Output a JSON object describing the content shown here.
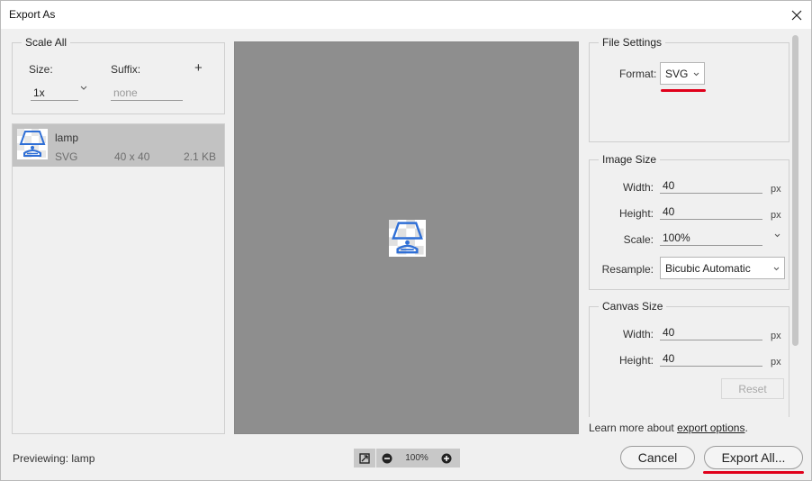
{
  "window": {
    "title": "Export As"
  },
  "scale_all": {
    "legend": "Scale All",
    "size_label": "Size:",
    "suffix_label": "Suffix:",
    "size_value": "1x",
    "suffix_placeholder": "none",
    "add_glyph": "+"
  },
  "files": [
    {
      "name": "lamp",
      "type": "SVG",
      "dims": "40 x 40",
      "size": "2.1 KB",
      "icon": "lamp-thumbnail-icon"
    }
  ],
  "previewing": {
    "label": "Previewing:",
    "name": "lamp"
  },
  "zoom": {
    "value": "100%"
  },
  "file_settings": {
    "legend": "File Settings",
    "format_label": "Format:",
    "format_value": "SVG"
  },
  "image_size": {
    "legend": "Image Size",
    "width_label": "Width:",
    "width_value": "40",
    "width_unit": "px",
    "height_label": "Height:",
    "height_value": "40",
    "height_unit": "px",
    "scale_label": "Scale:",
    "scale_value": "100%",
    "resample_label": "Resample:",
    "resample_value": "Bicubic Automatic"
  },
  "canvas_size": {
    "legend": "Canvas Size",
    "width_label": "Width:",
    "width_value": "40",
    "width_unit": "px",
    "height_label": "Height:",
    "height_value": "40",
    "height_unit": "px",
    "reset_label": "Reset"
  },
  "learn_more": {
    "prefix": "Learn more about ",
    "link": "export options",
    "suffix": "."
  },
  "buttons": {
    "cancel": "Cancel",
    "export_all": "Export All..."
  },
  "colors": {
    "highlight": "#e0001b",
    "preview_bg": "#8e8e8e",
    "selected_row": "#c2c2c2",
    "icon_blue": "#2f6fd6"
  }
}
